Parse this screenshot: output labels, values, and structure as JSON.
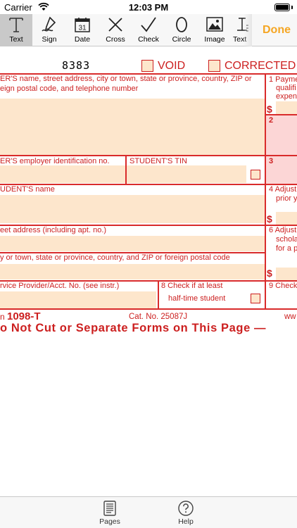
{
  "status_bar": {
    "carrier": "Carrier",
    "time": "12:03 PM"
  },
  "toolbar": {
    "tools": [
      {
        "label": "Text",
        "icon": "text-icon",
        "selected": true
      },
      {
        "label": "Sign",
        "icon": "sign-icon",
        "selected": false
      },
      {
        "label": "Date",
        "icon": "date-icon",
        "selected": false,
        "icon_text": "31"
      },
      {
        "label": "Cross",
        "icon": "cross-icon",
        "selected": false
      },
      {
        "label": "Check",
        "icon": "check-icon",
        "selected": false
      },
      {
        "label": "Circle",
        "icon": "circle-icon",
        "selected": false
      },
      {
        "label": "Image",
        "icon": "image-icon",
        "selected": false
      },
      {
        "label": "Text",
        "icon": "text-style-icon",
        "selected": false
      }
    ],
    "done_label": "Done",
    "accent_color": "#f5a623"
  },
  "document": {
    "form_number": "8383",
    "void_label": "VOID",
    "corrected_label": "CORRECTED",
    "filer_label_1": "ER'S name, street address, city or town, state or province, country, ZIP or",
    "filer_label_2": "eign postal code, and telephone number",
    "box1_label_1": "1 Payme",
    "box1_label_2": "qualifi",
    "box1_label_3": "expen",
    "box2_label": "2",
    "ein_label": "ER'S employer identification no.",
    "tin_label": "STUDENT'S TIN",
    "box3_label": "3",
    "student_name_label": "UDENT'S name",
    "box4_label_1": "4 Adjust",
    "box4_label_2": "prior y",
    "street_label": "eet address (including apt. no.)",
    "box6_label_1": "6 Adjust",
    "box6_label_2": "schola",
    "box6_label_3": "for a p",
    "city_label": "y or town, state or province, country, and ZIP or foreign postal code",
    "service_label": "rvice Provider/Acct. No. (see instr.)",
    "box8_label_1": "8 Check if at least",
    "box8_label_2": "half-time student",
    "box9_label": "9 Check",
    "dollar_sign": "$",
    "form_name_prefix": "n",
    "form_name": "1098-T",
    "catalog": "Cat. No. 25087J",
    "web_partial": "ww",
    "cut_notice": "o Not Cut or Separate Forms on This Page —"
  },
  "colors": {
    "form_red": "#cc1f1f",
    "field_fill": "#fde6cc",
    "pink_fill": "#fcd6d6"
  },
  "bottom_bar": {
    "tabs": [
      {
        "label": "Pages",
        "icon": "pages-icon"
      },
      {
        "label": "Help",
        "icon": "help-icon"
      }
    ]
  }
}
